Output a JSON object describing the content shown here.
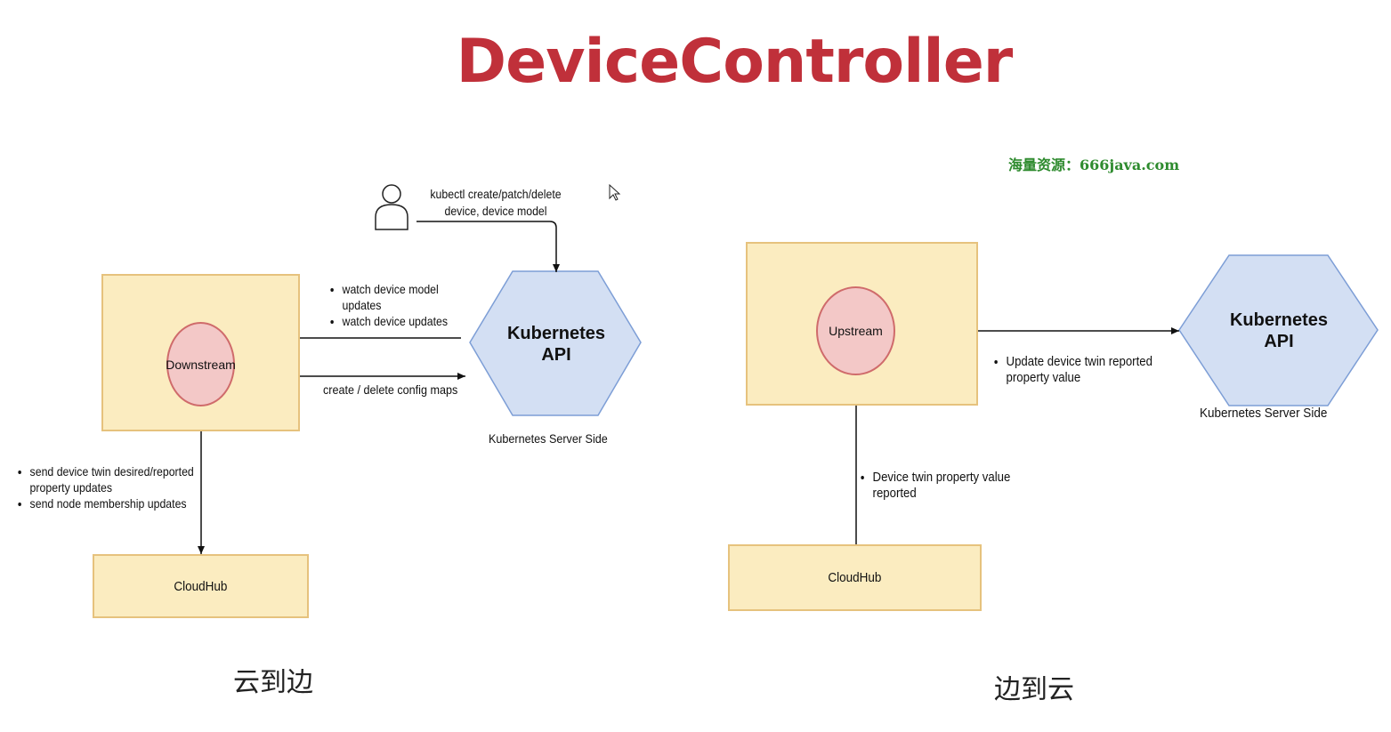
{
  "title": "DeviceController",
  "watermark": "海量资源：666java.com",
  "left": {
    "kubectl_line1": "kubectl create/patch/delete",
    "kubectl_line2": "device, device model",
    "watch_items": [
      "watch device model updates",
      "watch device updates"
    ],
    "create_label": "create / delete config maps",
    "downstream": "Downstream",
    "k8s_line1": "Kubernetes",
    "k8s_line2": "API",
    "k8s_side": "Kubernetes Server Side",
    "send_items": [
      "send device twin desired/reported property updates",
      "send node membership updates"
    ],
    "cloudhub": "CloudHub",
    "caption": "云到边"
  },
  "right": {
    "upstream": "Upstream",
    "update_item": "Update device twin reported property value",
    "k8s_line1": "Kubernetes",
    "k8s_line2": "API",
    "k8s_side": "Kubernetes Server Side",
    "device_item": "Device twin property value reported",
    "cloudhub": "CloudHub",
    "caption": "边到云"
  },
  "colors": {
    "title": "#c0303a",
    "box_fill": "#fbecc0",
    "circle_fill": "#f3c8c7",
    "hex_fill": "#d3dff3",
    "watermark": "#2e8b2e"
  },
  "icons": [
    "user-icon",
    "cursor-icon"
  ]
}
